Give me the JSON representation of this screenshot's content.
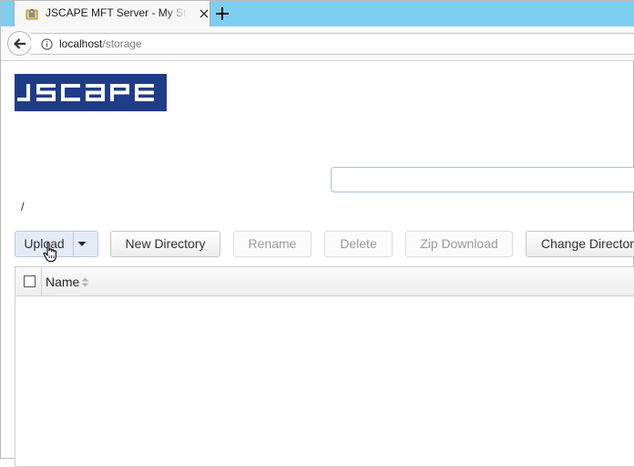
{
  "browser": {
    "tab_title": "JSCAPE MFT Server - My Storage",
    "url_host": "localhost",
    "url_path": "/storage"
  },
  "brand": {
    "logo_text": "JSCAPE",
    "logo_color": "#1f3c88"
  },
  "search": {
    "placeholder": "",
    "value": ""
  },
  "breadcrumb": {
    "path": "/"
  },
  "toolbar": {
    "upload_label": "Upload",
    "new_directory_label": "New Directory",
    "rename_label": "Rename",
    "delete_label": "Delete",
    "zip_download_label": "Zip Download",
    "change_directory_label": "Change Directory"
  },
  "file_table": {
    "columns": [
      "Name"
    ],
    "rows": []
  },
  "colors": {
    "tab_strip": "#7ccff1",
    "upload_button": "#e3ecf7",
    "search_border": "#a9c1dd"
  },
  "icons": {
    "favicon": "lock-folder-icon",
    "tab_close": "close-icon",
    "new_tab": "plus-icon",
    "back": "back-arrow-icon",
    "site_info": "info-icon",
    "upload_menu": "caret-down-icon",
    "sort": "sort-icon",
    "cursor": "hand-pointer-icon"
  }
}
